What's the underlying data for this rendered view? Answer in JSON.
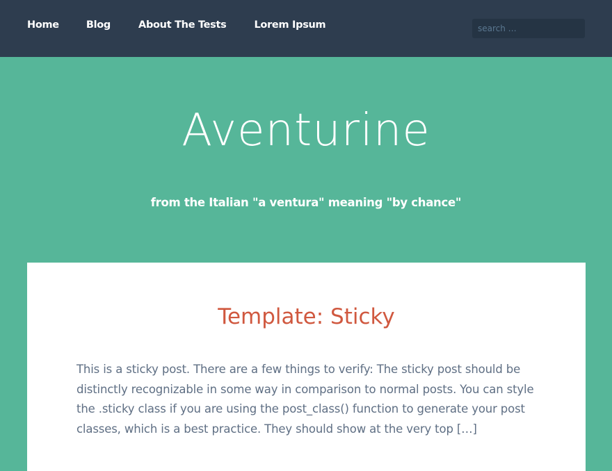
{
  "nav": {
    "items": [
      {
        "label": "Home"
      },
      {
        "label": "Blog"
      },
      {
        "label": "About The Tests"
      },
      {
        "label": "Lorem Ipsum"
      }
    ]
  },
  "search": {
    "placeholder": "search …"
  },
  "site": {
    "title": "Aventurine",
    "tagline": "from the Italian \"a ventura\" meaning \"by chance\""
  },
  "post": {
    "title": "Template: Sticky",
    "excerpt": "This is a sticky post. There are a few things to verify: The sticky post should be distinctly recognizable in some way in comparison to normal posts. You can style the .sticky class if you are using the post_class() function to generate your post classes, which is a best practice. They should show at the very top […]"
  },
  "colors": {
    "topbar_bg": "#2e3d4f",
    "page_bg": "#56b699",
    "search_bg": "#253444",
    "post_title": "#d0583f",
    "body_text": "#5f6f84",
    "card_bg": "#ffffff"
  }
}
